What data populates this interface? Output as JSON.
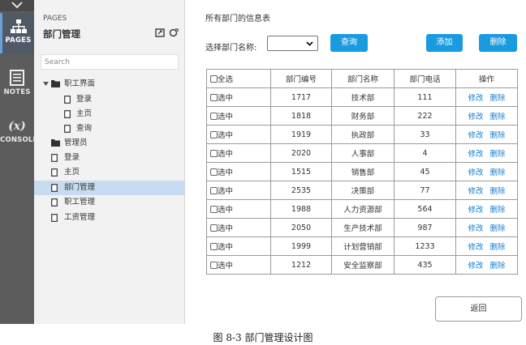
{
  "sidebar_rail": {
    "items": [
      {
        "label": "PAGES",
        "icon": "sitemap-icon",
        "active": true
      },
      {
        "label": "NOTES",
        "icon": "notes-icon",
        "active": false
      },
      {
        "label": "CONSOLE",
        "glyph": "(x)",
        "icon": "variable-icon",
        "active": false
      }
    ]
  },
  "pages_panel": {
    "section_label": "PAGES",
    "title": "部门管理",
    "search_placeholder": "Search",
    "tree": [
      {
        "label": "职工界面",
        "type": "folder",
        "level": 0,
        "expanded": true
      },
      {
        "label": "登录",
        "type": "page",
        "level": 1
      },
      {
        "label": "主页",
        "type": "page",
        "level": 1
      },
      {
        "label": "查询",
        "type": "page",
        "level": 1
      },
      {
        "label": "管理员",
        "type": "folder",
        "level": 0,
        "expanded": false
      },
      {
        "label": "登录",
        "type": "page",
        "level": 0
      },
      {
        "label": "主页",
        "type": "page",
        "level": 0
      },
      {
        "label": "部门管理",
        "type": "page",
        "level": 0,
        "selected": true
      },
      {
        "label": "职工管理",
        "type": "page",
        "level": 0
      },
      {
        "label": "工资管理",
        "type": "page",
        "level": 0
      }
    ]
  },
  "main": {
    "heading": "所有部门的信息表",
    "select_label": "选择部门名称:",
    "select_value": "",
    "query_button": "查询",
    "add_button": "添加",
    "delete_button": "删除",
    "back_button": "返回",
    "table": {
      "columns": [
        "全选",
        "部门编号",
        "部门名称",
        "部门电话",
        "操作"
      ],
      "row_check_label": "选中",
      "edit_label": "修改",
      "delete_label": "删除",
      "rows": [
        {
          "id": "1717",
          "name": "技术部",
          "phone": "111"
        },
        {
          "id": "1818",
          "name": "财务部",
          "phone": "222"
        },
        {
          "id": "1919",
          "name": "执政部",
          "phone": "33"
        },
        {
          "id": "2020",
          "name": "人事部",
          "phone": "4"
        },
        {
          "id": "1515",
          "name": "销售部",
          "phone": "45"
        },
        {
          "id": "2535",
          "name": "决策部",
          "phone": "77"
        },
        {
          "id": "1988",
          "name": "人力资源部",
          "phone": "564"
        },
        {
          "id": "2050",
          "name": "生产技术部",
          "phone": "987"
        },
        {
          "id": "1999",
          "name": "计划营销部",
          "phone": "1233"
        },
        {
          "id": "1212",
          "name": "安全监察部",
          "phone": "435"
        }
      ]
    }
  },
  "caption": "图 8-3  部门管理设计图",
  "colors": {
    "primary_button": "#1a9be0",
    "link": "#1a7fd0",
    "rail_bg": "#5c5c5c",
    "panel_bg": "#f2f2f2",
    "selected_row": "#c7dcf0"
  }
}
